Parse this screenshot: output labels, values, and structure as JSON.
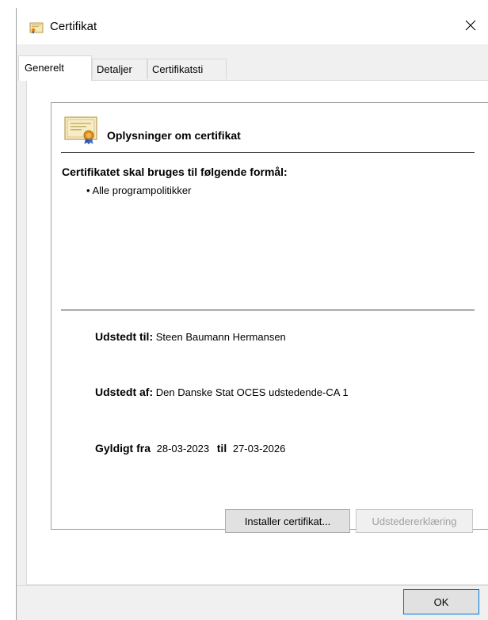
{
  "window": {
    "title": "Certifikat"
  },
  "tabs": [
    {
      "label": "Generelt",
      "active": true
    },
    {
      "label": "Detaljer",
      "active": false
    },
    {
      "label": "Certifikatsti",
      "active": false
    }
  ],
  "certificate": {
    "header": "Oplysninger om certifikat",
    "purpose_heading": "Certifikatet skal bruges til følgende formål:",
    "purposes": [
      "• Alle programpolitikker"
    ],
    "issued_to_label": "Udstedt til:",
    "issued_to_value": "Steen Baumann Hermansen",
    "issued_by_label": "Udstedt af:",
    "issued_by_value": "Den Danske Stat OCES udstedende-CA 1",
    "valid_from_label": "Gyldigt fra",
    "valid_from_value": "28-03-2023",
    "valid_to_label": "til",
    "valid_to_value": "27-03-2026"
  },
  "buttons": {
    "install": "Installer certifikat...",
    "issuer_statement": "Udstedererklæring",
    "ok": "OK"
  },
  "icons": {
    "title": "certificate-icon",
    "close": "close-icon",
    "cert_large": "certificate-icon"
  }
}
